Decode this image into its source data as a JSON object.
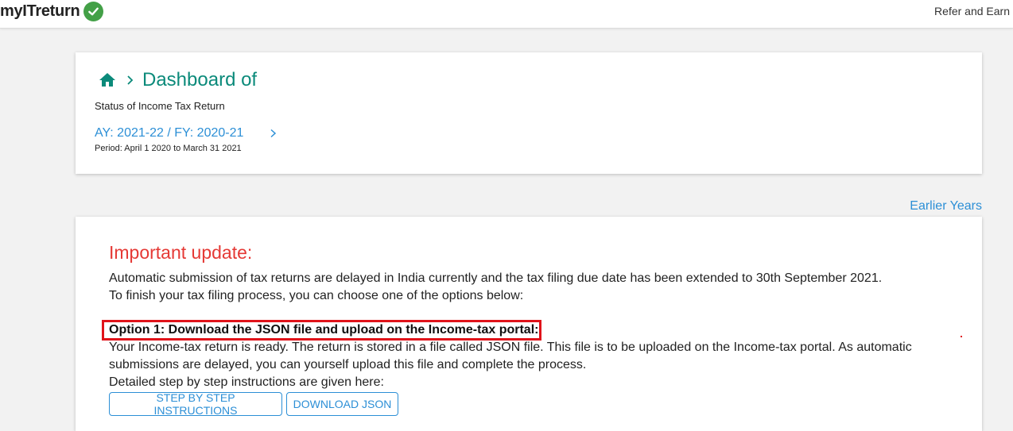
{
  "header": {
    "logo_text": "myITreturn",
    "refer_label": "Refer and Earn"
  },
  "dashboard": {
    "title": "Dashboard of",
    "status_text": "Status of Income Tax Return",
    "ay_label": "AY: 2021-22 / FY: 2020-21",
    "period": "Period: April 1 2020 to March 31 2021"
  },
  "earlier_years_label": "Earlier Years",
  "update": {
    "title": "Important update:",
    "line1": "Automatic submission of tax returns are delayed in India currently and the tax filing due date has been extended to 30th September 2021.",
    "line2": "To finish your tax filing process, you can choose one of the options below:",
    "option1_title": "Option 1: Download the JSON file and upload on the Income-tax portal:",
    "option1_line1": "Your Income-tax return is ready. The return is stored in a file called JSON file. This file is to be uploaded on the Income-tax portal. As automatic",
    "option1_line2": "submissions are delayed, you can yourself upload this file and complete the process.",
    "instructions_text": "Detailed step by step instructions are given here:",
    "btn_instructions": "STEP BY STEP INSTRUCTIONS",
    "btn_download": "DOWNLOAD JSON"
  },
  "colors": {
    "accent_teal": "#0b8a7a",
    "link_blue": "#2c8fd6",
    "alert_red": "#e53935",
    "check_green": "#43a047"
  }
}
